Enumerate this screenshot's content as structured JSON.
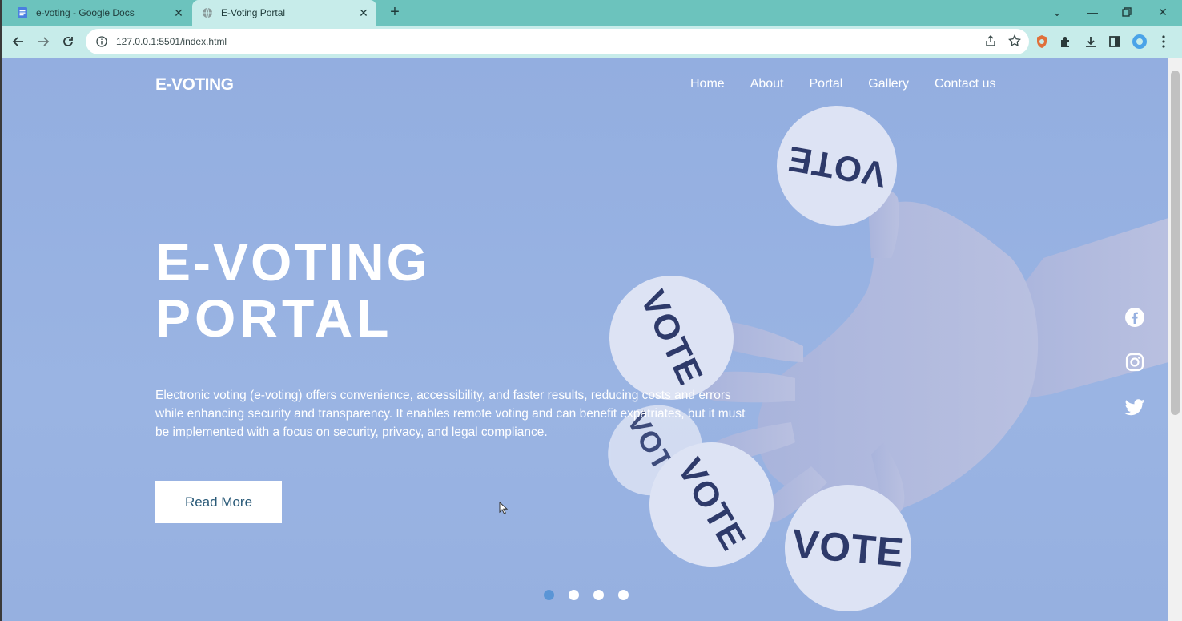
{
  "browser": {
    "tabs": [
      {
        "title": "e-voting - Google Docs",
        "active": false,
        "icon": "docs-icon"
      },
      {
        "title": "E-Voting Portal",
        "active": true,
        "icon": "globe-icon"
      }
    ],
    "new_tab": "+",
    "url": "127.0.0.1:5501/index.html"
  },
  "site": {
    "logo": "E-VOTING",
    "nav": [
      "Home",
      "About",
      "Portal",
      "Gallery",
      "Contact us"
    ],
    "hero": {
      "title_line1": "E-VOTING",
      "title_line2": "PORTAL",
      "text": "Electronic voting (e-voting) offers convenience, accessibility, and faster results, reducing costs and errors while enhancing security and transparency. It enables remote voting and can benefit expatriates, but it must be implemented with a focus on security, privacy, and legal compliance.",
      "button": "Read More"
    },
    "badges": [
      "VOTE",
      "VOTE",
      "VOTE",
      "VOTE",
      "VOTE"
    ],
    "social": [
      "facebook-icon",
      "instagram-icon",
      "twitter-icon"
    ],
    "slider": {
      "total": 4,
      "active": 0
    }
  },
  "colors": {
    "tabstrip": "#6cc3bd",
    "toolbar": "#c7ecea",
    "hero_bg": "#96b0e0",
    "accent_dot": "#5a95d6",
    "button_text": "#2a5a78"
  }
}
